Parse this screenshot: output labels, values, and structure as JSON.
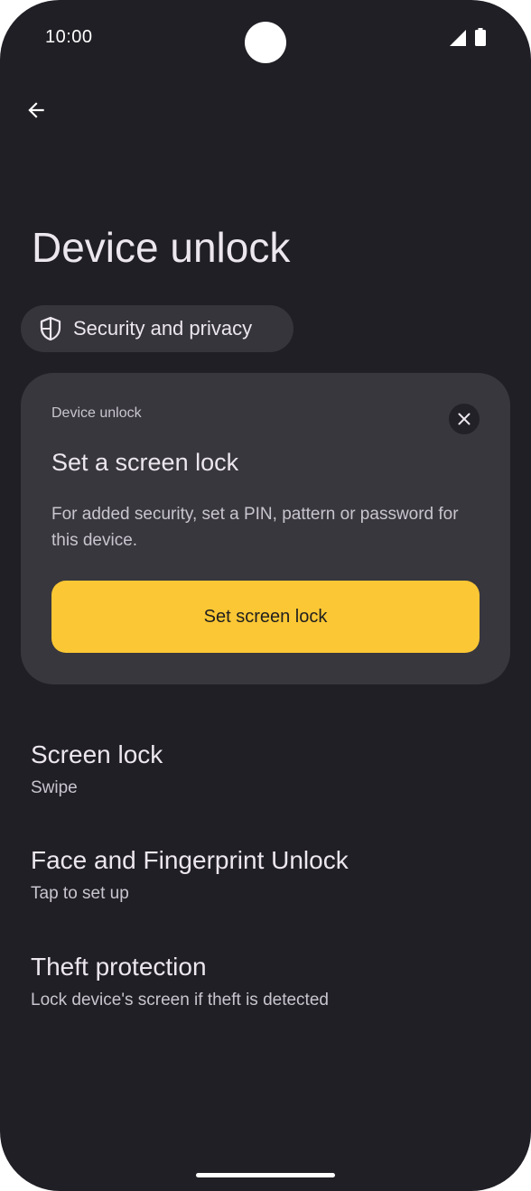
{
  "status_bar": {
    "time": "10:00",
    "signal_icon": "cell-signal-icon",
    "battery_icon": "battery-icon"
  },
  "toolbar": {
    "back_icon": "arrow-left-icon"
  },
  "page": {
    "title": "Device unlock"
  },
  "breadcrumb": {
    "icon": "shield-icon",
    "label": "Security and privacy"
  },
  "suggestion_card": {
    "eyebrow": "Device unlock",
    "title": "Set a screen lock",
    "body": "For added security, set a PIN, pattern or password for this device.",
    "button_label": "Set screen lock",
    "close_icon": "close-icon",
    "accent_color": "#fbc734"
  },
  "settings": {
    "items": [
      {
        "title": "Screen lock",
        "subtitle": "Swipe"
      },
      {
        "title": "Face and Fingerprint Unlock",
        "subtitle": "Tap to set up"
      },
      {
        "title": "Theft protection",
        "subtitle": "Lock device's screen if theft is detected"
      }
    ]
  },
  "colors": {
    "background": "#201f25",
    "card": "#38373d",
    "chip": "#36353b",
    "accent": "#fbc734"
  }
}
